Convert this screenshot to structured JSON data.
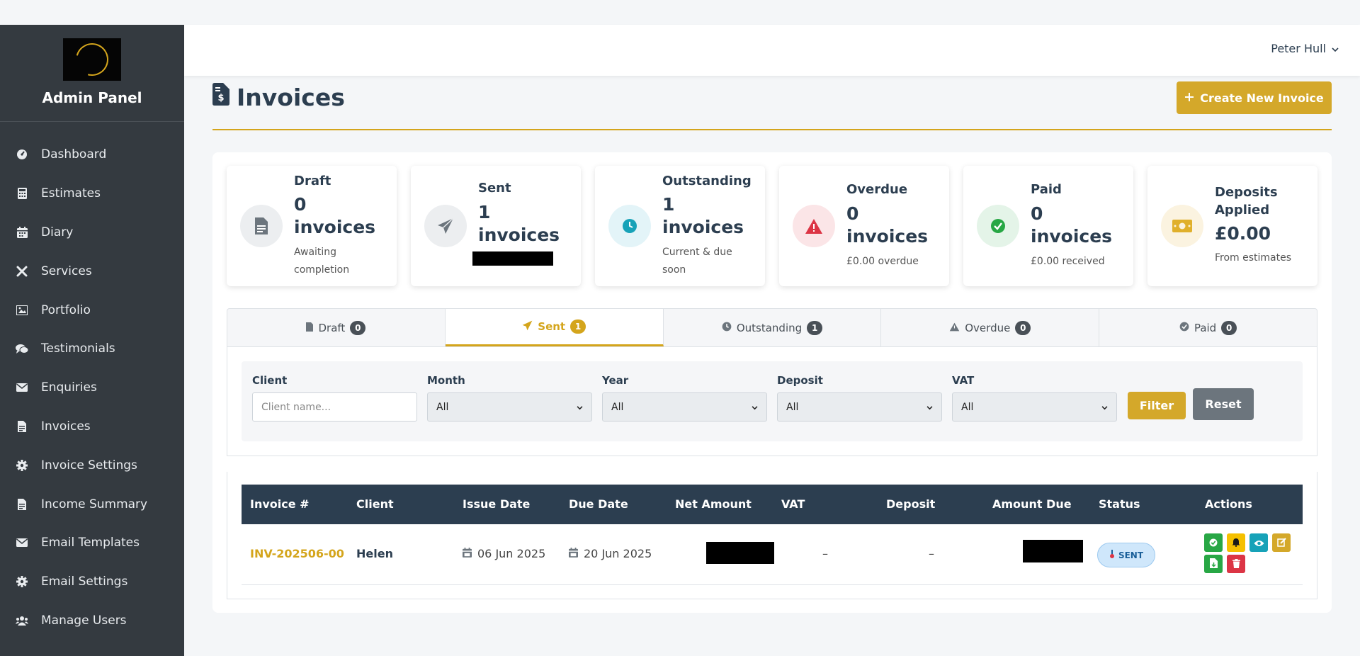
{
  "sidebar": {
    "brand_title": "Admin Panel",
    "items": [
      {
        "label": "Dashboard",
        "icon": "dashboard-icon"
      },
      {
        "label": "Estimates",
        "icon": "calculator-icon"
      },
      {
        "label": "Diary",
        "icon": "calendar-icon"
      },
      {
        "label": "Services",
        "icon": "tools-icon"
      },
      {
        "label": "Portfolio",
        "icon": "image-icon"
      },
      {
        "label": "Testimonials",
        "icon": "comments-icon"
      },
      {
        "label": "Enquiries",
        "icon": "envelope-icon"
      },
      {
        "label": "Invoices",
        "icon": "invoice-icon"
      },
      {
        "label": "Invoice Settings",
        "icon": "gear-icon"
      },
      {
        "label": "Income Summary",
        "icon": "document-icon"
      },
      {
        "label": "Email Templates",
        "icon": "envelope-icon"
      },
      {
        "label": "Email Settings",
        "icon": "gear-icon"
      },
      {
        "label": "Manage Users",
        "icon": "users-icon"
      }
    ]
  },
  "topbar": {
    "user_name": "Peter Hull"
  },
  "header": {
    "title": "Invoices",
    "create_button": "Create New Invoice"
  },
  "stats": {
    "draft": {
      "title": "Draft",
      "value": "0 invoices",
      "sub": "Awaiting completion"
    },
    "sent": {
      "title": "Sent",
      "value": "1 invoices"
    },
    "outstanding": {
      "title": "Outstanding",
      "value": "1 invoices",
      "sub": "Current & due soon"
    },
    "overdue": {
      "title": "Overdue",
      "value": "0 invoices",
      "sub": "£0.00 overdue"
    },
    "paid": {
      "title": "Paid",
      "value": "0 invoices",
      "sub": "£0.00 received"
    },
    "deposits": {
      "title": "Deposits Applied",
      "value": "£0.00",
      "sub": "From estimates"
    }
  },
  "tabs": [
    {
      "label": "Draft",
      "count": "0"
    },
    {
      "label": "Sent",
      "count": "1"
    },
    {
      "label": "Outstanding",
      "count": "1"
    },
    {
      "label": "Overdue",
      "count": "0"
    },
    {
      "label": "Paid",
      "count": "0"
    }
  ],
  "filters": {
    "client_label": "Client",
    "client_placeholder": "Client name...",
    "month_label": "Month",
    "month_value": "All",
    "year_label": "Year",
    "year_value": "All",
    "deposit_label": "Deposit",
    "deposit_value": "All",
    "vat_label": "VAT",
    "vat_value": "All",
    "filter_button": "Filter",
    "reset_button": "Reset"
  },
  "table": {
    "headers": [
      "Invoice #",
      "Client",
      "Issue Date",
      "Due Date",
      "Net Amount",
      "VAT",
      "Deposit",
      "Amount Due",
      "Status",
      "Actions"
    ],
    "rows": [
      {
        "invoice": "INV-202506-00",
        "client": "Helen",
        "issue_date": "06 Jun 2025",
        "due_date": "20 Jun 2025",
        "vat": "–",
        "deposit": "–",
        "status": "SENT"
      }
    ]
  },
  "colors": {
    "accent": "#d4a51c",
    "sidebar": "#343a40",
    "table_header": "#2c3e50",
    "secondary": "#6c757d"
  }
}
